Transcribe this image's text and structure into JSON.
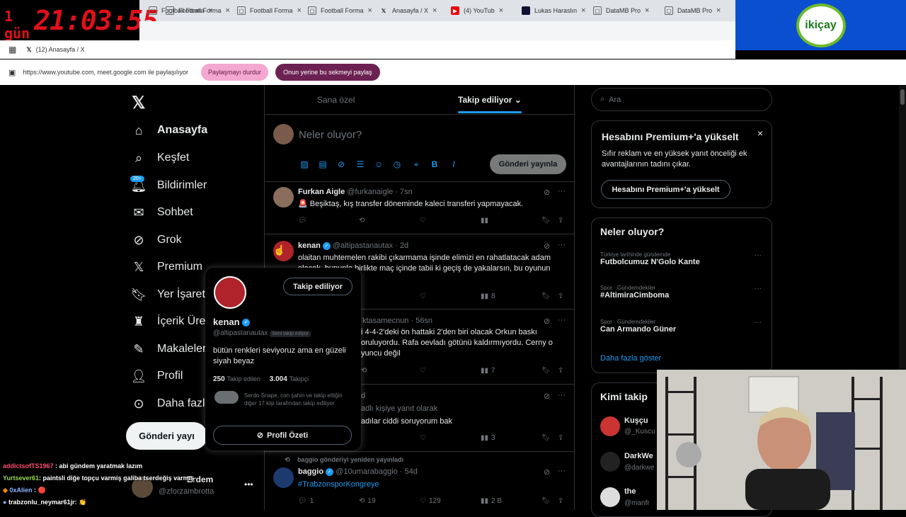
{
  "stream": {
    "timer_prefix": "1 gün",
    "timer_value": "21:03:55",
    "sponsor_logo": "ikiçay"
  },
  "browser": {
    "tabs": [
      {
        "label": "Football Forma",
        "icon": "page-icon"
      },
      {
        "label": "Football Forma",
        "icon": "page-icon"
      },
      {
        "label": "Football Forma",
        "icon": "page-icon"
      },
      {
        "label": "Anasayfa / X",
        "icon": "x-icon"
      },
      {
        "label": "(4) YouTub",
        "icon": "youtube-icon"
      },
      {
        "label": "Lukas Haraslın",
        "icon": "page-icon"
      },
      {
        "label": "DataMB Pro",
        "icon": "page-icon"
      },
      {
        "label": "DataMB Pro",
        "icon": "page-icon"
      }
    ],
    "window_title": "(12) Anasayfa / X",
    "share_text": "https://www.youtube.com, meet.google.com ile paylaşılıyor",
    "stop_share": "Paylaşmayı durdur",
    "share_this_tab": "Onun yerine bu sekmeyi paylaş"
  },
  "nav": {
    "items": [
      {
        "label": "Anasayfa",
        "icon": "home-icon"
      },
      {
        "label": "Keşfet",
        "icon": "search-icon"
      },
      {
        "label": "Bildirimler",
        "icon": "bell-icon"
      },
      {
        "label": "Sohbet",
        "icon": "mail-icon"
      },
      {
        "label": "Grok",
        "icon": "grok-icon"
      },
      {
        "label": "Premium",
        "icon": "x-icon"
      },
      {
        "label": "Yer İşaretle",
        "icon": "bookmark-icon"
      },
      {
        "label": "İçerik Üreti",
        "icon": "creator-icon"
      },
      {
        "label": "Makaleler",
        "icon": "article-icon"
      },
      {
        "label": "Profil",
        "icon": "person-icon"
      },
      {
        "label": "Daha fazla",
        "icon": "more-icon"
      }
    ],
    "notif_badge": "20+",
    "post_button": "Gönderi yayı",
    "account_name": "Erdem",
    "account_handle": "@zforzambrotta"
  },
  "feed": {
    "tab_for_you": "Sana özel",
    "tab_following": "Takip ediliyor",
    "compose_placeholder": "Neler oluyor?",
    "publish_button": "Gönderi yayınla",
    "tweets": [
      {
        "name": "Furkan Aigle",
        "handle": "@furkanaigle · 7sn",
        "text": "🚨 Beşiktaş, kış transfer döneminde kaleci transferi yapmayacak.",
        "views": ""
      },
      {
        "name": "kenan",
        "handle": "@altipastanautax · 2d",
        "text": "olaitan muhtemelen rakibi çıkarmama işinde elimizi en rahatlatacak adam olacak, bununla birlikte maç içinde tabii ki geçiş de yakalarsın, bu oyunun",
        "views": "8"
      },
      {
        "name": "",
        "handle": "ktasamecnun · 56sn",
        "text": "i 4-4-2'deki ön hattaki 2'den biri olacak Orkun baskı oruluyordu. Rafa oevladı götünü kaldırmıyordu. Cerny o yuncu değil",
        "views": "7"
      },
      {
        "name": "",
        "handle": "d",
        "text_line1": "adlı kişiye yanıt olarak",
        "text_line2": "adılar ciddi soruyorum bak",
        "views": "3"
      }
    ],
    "retweet_note": "baggio gönderiyi yeniden yayınladı",
    "last_tweet": {
      "name": "baggio",
      "handle": "@10umarabaggio · 54d",
      "text": "#TrabzonsporKongreye",
      "replies": "1",
      "retweets": "19",
      "likes": "129",
      "views": "2 B"
    }
  },
  "hover_card": {
    "follow_button": "Takip ediliyor",
    "name": "kenan",
    "handle": "@altipastanautax",
    "follows_you": "Seni takip ediyor",
    "bio": "bütün renkleri seviyoruz ama en güzeli siyah beyaz",
    "following_count": "250",
    "following_label": "Takip edilen",
    "followers_count": "3.004",
    "followers_label": "Takipçi",
    "mutuals": "Serdo Snape, con şahin ve takip ettiğin diğer 17 kişi tarafından takip ediliyor",
    "profile_summary": "Profil Özeti"
  },
  "right": {
    "search_placeholder": "Ara",
    "premium_title": "Hesabını Premium+'a yükselt",
    "premium_text": "Sıfır reklam ve en yüksek yanıt önceliği ek avantajlarının tadını çıkar.",
    "premium_button": "Hesabını Premium+'a yükselt",
    "trends_title": "Neler oluyor?",
    "trends": [
      {
        "meta": "Türkiye tarihinde gündemde",
        "name": "Futbolcumuz N'Golo Kante"
      },
      {
        "meta": "Spor · Gündemdekiler",
        "name": "#AltimiraCimboma"
      },
      {
        "meta": "Spor · Gündemdekiler",
        "name": "Can Armando Güner"
      }
    ],
    "show_more": "Daha fazla göster",
    "who_to_follow_title": "Kimi takip",
    "suggestions": [
      {
        "name": "Kuşçu",
        "handle": "@_Kuscu"
      },
      {
        "name": "DarkWe",
        "handle": "@darkwe"
      },
      {
        "name": "the",
        "handle": "@manfr"
      }
    ]
  },
  "chat": [
    {
      "user": "addictsofTS1967",
      "msg": ": abi gündem yaratmak lazım",
      "color": "#ff4d6d"
    },
    {
      "user": "Yurtsever61",
      "msg": ": paintsli diğe topçu varmiş galiba tserdeğiş varmış",
      "color": "#9ad94f"
    },
    {
      "user": "0xAlien",
      "msg": ": 🔴",
      "color": "#8ab4ff"
    },
    {
      "user": "trabzonlu_neymar61jr",
      "msg": ": 👏",
      "color": "#ffffff"
    }
  ]
}
